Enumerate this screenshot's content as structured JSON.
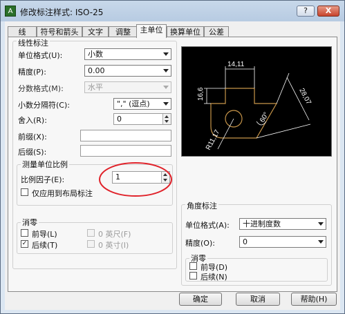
{
  "window": {
    "title": "修改标注样式: ISO-25",
    "icon_glyph": "A",
    "help_glyph": "?",
    "close_glyph": "X"
  },
  "tabs": [
    {
      "label": "线"
    },
    {
      "label": "符号和箭头"
    },
    {
      "label": "文字"
    },
    {
      "label": "调整"
    },
    {
      "label": "主单位",
      "active": true
    },
    {
      "label": "换算单位"
    },
    {
      "label": "公差"
    }
  ],
  "linear": {
    "group_label": "线性标注",
    "unit_format": {
      "label": "单位格式(U):",
      "value": "小数"
    },
    "precision": {
      "label": "精度(P):",
      "value": "0.00"
    },
    "fraction_format": {
      "label": "分数格式(M):",
      "value": "水平"
    },
    "decimal_separator": {
      "label": "小数分隔符(C):",
      "value": "\",\" (逗点)"
    },
    "round_off": {
      "label": "舍入(R):",
      "value": "0"
    },
    "prefix": {
      "label": "前缀(X):",
      "value": ""
    },
    "suffix": {
      "label": "后缀(S):",
      "value": ""
    }
  },
  "measurement_scale": {
    "group_label": "测量单位比例",
    "scale_factor": {
      "label": "比例因子(E):",
      "value": "1"
    },
    "layout_only": {
      "label": "仅应用到布局标注",
      "checked": false
    }
  },
  "linear_zero_suppression": {
    "group_label": "消零",
    "leading": {
      "label": "前导(L)",
      "checked": false
    },
    "trailing": {
      "label": "后续(T)",
      "checked": true
    },
    "feet": {
      "label": "0 英尺(F)",
      "checked": false
    },
    "inches": {
      "label": "0 英寸(I)",
      "checked": false
    }
  },
  "preview": {
    "dim_top": "14,11",
    "dim_left": "16,6",
    "dim_right": "28,07",
    "dim_angle": "60°",
    "dim_radius": "R11,17"
  },
  "angular": {
    "group_label": "角度标注",
    "unit_format": {
      "label": "单位格式(A):",
      "value": "十进制度数"
    },
    "precision": {
      "label": "精度(O):",
      "value": "0"
    },
    "zero_group_label": "消零",
    "leading": {
      "label": "前导(D)",
      "checked": false
    },
    "trailing": {
      "label": "后续(N)",
      "checked": false
    }
  },
  "footer": {
    "ok_label": "确定",
    "cancel_label": "取消",
    "help_label": "帮助(H)"
  },
  "colors": {
    "preview_bg": "#000000",
    "preview_geometry": "#c8964a",
    "preview_dimension": "#ffffff",
    "annotation": "#e0222a"
  },
  "chk_mark": "✓"
}
